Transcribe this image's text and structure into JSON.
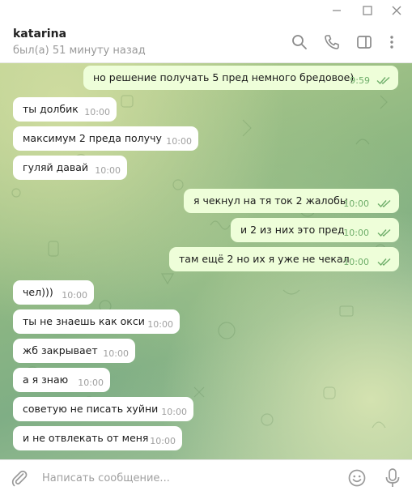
{
  "window": {
    "minimize_icon": "minimize-icon",
    "maximize_icon": "maximize-icon",
    "close_icon": "close-icon"
  },
  "header": {
    "title": "katarina",
    "status": "был(а) 51 минуту назад",
    "icons": [
      "search-icon",
      "phone-icon",
      "sidebar-toggle-icon",
      "more-vertical-icon"
    ]
  },
  "messages": [
    {
      "dir": "out",
      "text": "но решение получать 5 пред немного бредовое)",
      "time": "9:59",
      "read": true
    },
    {
      "dir": "in",
      "text": "ты долбик",
      "time": "10:00"
    },
    {
      "dir": "in",
      "text": "максимум 2 преда получу",
      "time": "10:00"
    },
    {
      "dir": "in",
      "text": "гуляй давай",
      "time": "10:00"
    },
    {
      "dir": "out",
      "text": "я чекнул на тя ток 2 жалобы",
      "time": "10:00",
      "read": true
    },
    {
      "dir": "out",
      "text": "и 2 из них это пред",
      "time": "10:00",
      "read": true
    },
    {
      "dir": "out",
      "text": "там ещё 2 но их я уже не чекал",
      "time": "10:00",
      "read": true
    },
    {
      "dir": "in",
      "text": "чел)))",
      "time": "10:00"
    },
    {
      "dir": "in",
      "text": "ты не знаешь как окси",
      "time": "10:00"
    },
    {
      "dir": "in",
      "text": "жб закрывает",
      "time": "10:00"
    },
    {
      "dir": "in",
      "text": "а я знаю",
      "time": "10:00"
    },
    {
      "dir": "in",
      "text": "советую не писать хуйни",
      "time": "10:00"
    },
    {
      "dir": "in",
      "text": "и не отвлекать от меня",
      "time": "10:00"
    }
  ],
  "composer": {
    "placeholder": "Написать сообщение...",
    "value": ""
  },
  "colors": {
    "incoming_bubble": "#ffffff",
    "outgoing_bubble": "#eefed9",
    "read_check": "#6fae6a"
  }
}
